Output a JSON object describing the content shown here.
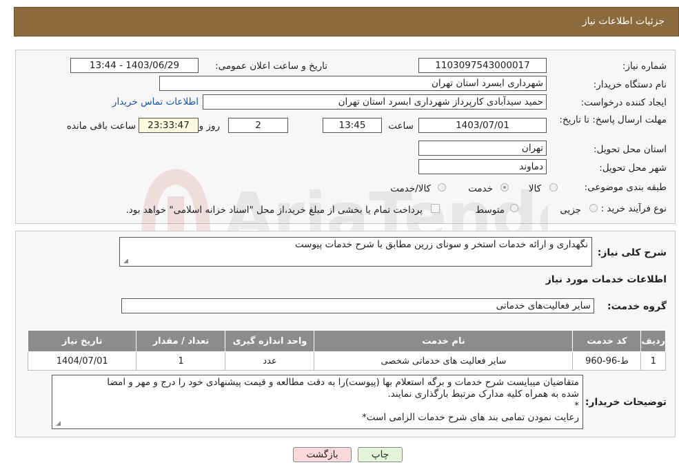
{
  "page": {
    "title": "جزئیات اطلاعات نیاز"
  },
  "details": {
    "need_number_label": "شماره نیاز:",
    "need_number": "1103097543000017",
    "announce_label": "تاریخ و ساعت اعلان عمومی:",
    "announce_value": "1403/06/29 - 13:44",
    "buyer_org_label": "نام دستگاه خریدار:",
    "buyer_org": "شهرداری ابسرد استان تهران",
    "creator_label": "ایجاد کننده درخواست:",
    "creator": "حمید سیدآبادی کارپرداز شهرداری ابسرد استان تهران",
    "contact_link": "اطلاعات تماس خریدار",
    "deadline_label": "مهلت ارسال پاسخ: تا تاریخ:",
    "deadline_date": "1403/07/01",
    "time_label": "ساعت",
    "deadline_time": "13:45",
    "days_value": "2",
    "days_label": "روز و",
    "remaining_time": "23:33:47",
    "remaining_label": "ساعت باقی مانده",
    "province_label": "استان محل تحویل:",
    "province": "تهران",
    "city_label": "شهر محل تحویل:",
    "city": "دماوند",
    "category_label": "طبقه بندی موضوعی:",
    "category_options": [
      {
        "label": "کالا",
        "checked": false
      },
      {
        "label": "خدمت",
        "checked": true
      },
      {
        "label": "کالا/خدمت",
        "checked": false
      }
    ],
    "process_label": "نوع فرآیند خرید :",
    "process_options": [
      {
        "label": "جزیی",
        "checked": false
      },
      {
        "label": "متوسط",
        "checked": false
      }
    ],
    "payment_note": "پرداخت تمام یا بخشی از مبلغ خرید،از محل \"اسناد خزانه اسلامی\" خواهد بود."
  },
  "summary": {
    "label": "شرح کلی نیاز:",
    "value": "نگهداری و ارائه خدمات استخر و سونای زرین مطابق با شرح خدمات پیوست",
    "services_title": "اطلاعات خدمات مورد نیاز",
    "service_group_label": "گروه خدمت:",
    "service_group": "سایر فعالیت‌های خدماتی"
  },
  "table": {
    "columns": [
      "ردیف",
      "کد خدمت",
      "نام خدمت",
      "واحد اندازه گیری",
      "تعداد / مقدار",
      "تاریخ نیاز"
    ],
    "rows": [
      [
        "1",
        "ط-96-960",
        "سایر فعالیت های خدماتی شخصی",
        "عدد",
        "1",
        "1404/07/01"
      ]
    ]
  },
  "buyer_notes": {
    "label": "توضیحات خریدار:",
    "lines": [
      "متقاضیان میبایست شرح خدمات و برگه استعلام بها (پیوست)را به دقت مطالعه و قیمت پیشنهادی خود را درج و مهر و امضا",
      "شده به همراه کلیه مدارک مرتبط بارگذاری نمایند.",
      "*",
      "رعایت نمودن تمامی بند های شرح خدمات الزامی است*"
    ]
  },
  "buttons": {
    "print": "چاپ",
    "back": "بازگشت"
  },
  "colors": {
    "header": "#8b6a3d",
    "table_header": "#8c8c8c",
    "link": "#1a55b0",
    "back_button": "#f9d9d9",
    "print_button": "#e3f5d9"
  },
  "watermark": {
    "text": "AriaTender.neT"
  }
}
